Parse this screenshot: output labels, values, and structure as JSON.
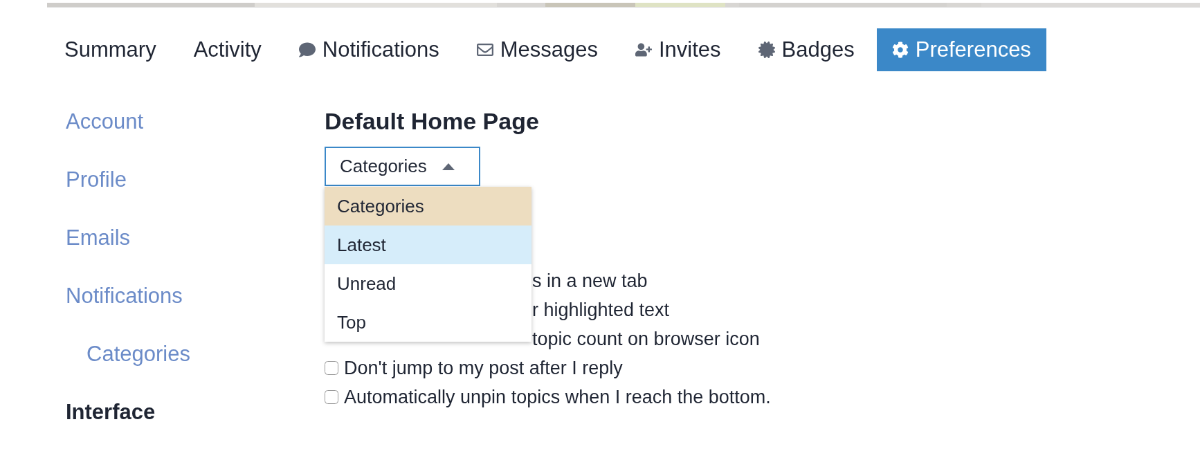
{
  "tabs": [
    {
      "label": "Summary",
      "selected": false
    },
    {
      "label": "Activity",
      "selected": false
    },
    {
      "label": "Notifications",
      "selected": false
    },
    {
      "label": "Messages",
      "selected": false
    },
    {
      "label": "Invites",
      "selected": false
    },
    {
      "label": "Badges",
      "selected": false
    },
    {
      "label": "Preferences",
      "selected": true
    }
  ],
  "sidebar": {
    "items": [
      {
        "label": "Account",
        "selected": false
      },
      {
        "label": "Profile",
        "selected": false
      },
      {
        "label": "Emails",
        "selected": false
      },
      {
        "label": "Notifications",
        "selected": false,
        "children": [
          {
            "label": "Categories",
            "selected": false
          }
        ]
      },
      {
        "label": "Interface",
        "selected": true
      }
    ]
  },
  "default_home_page": {
    "heading": "Default Home Page",
    "select": {
      "value": "Categories",
      "expanded": true,
      "options": [
        {
          "label": "Categories",
          "selected": true,
          "hovered": false
        },
        {
          "label": "Latest",
          "selected": false,
          "hovered": true
        },
        {
          "label": "Unread",
          "selected": false,
          "hovered": false
        },
        {
          "label": "Top",
          "selected": false,
          "hovered": false
        }
      ]
    }
  },
  "options": [
    {
      "label": "s in a new tab",
      "covered": true
    },
    {
      "label": "r highlighted text",
      "covered": true
    },
    {
      "label": "topic count on browser icon",
      "covered": true
    },
    {
      "label": "Don't jump to my post after I reply",
      "covered": false,
      "checked": false
    },
    {
      "label": "Automatically unpin topics when I reach the bottom.",
      "covered": false,
      "checked": false
    }
  ]
}
